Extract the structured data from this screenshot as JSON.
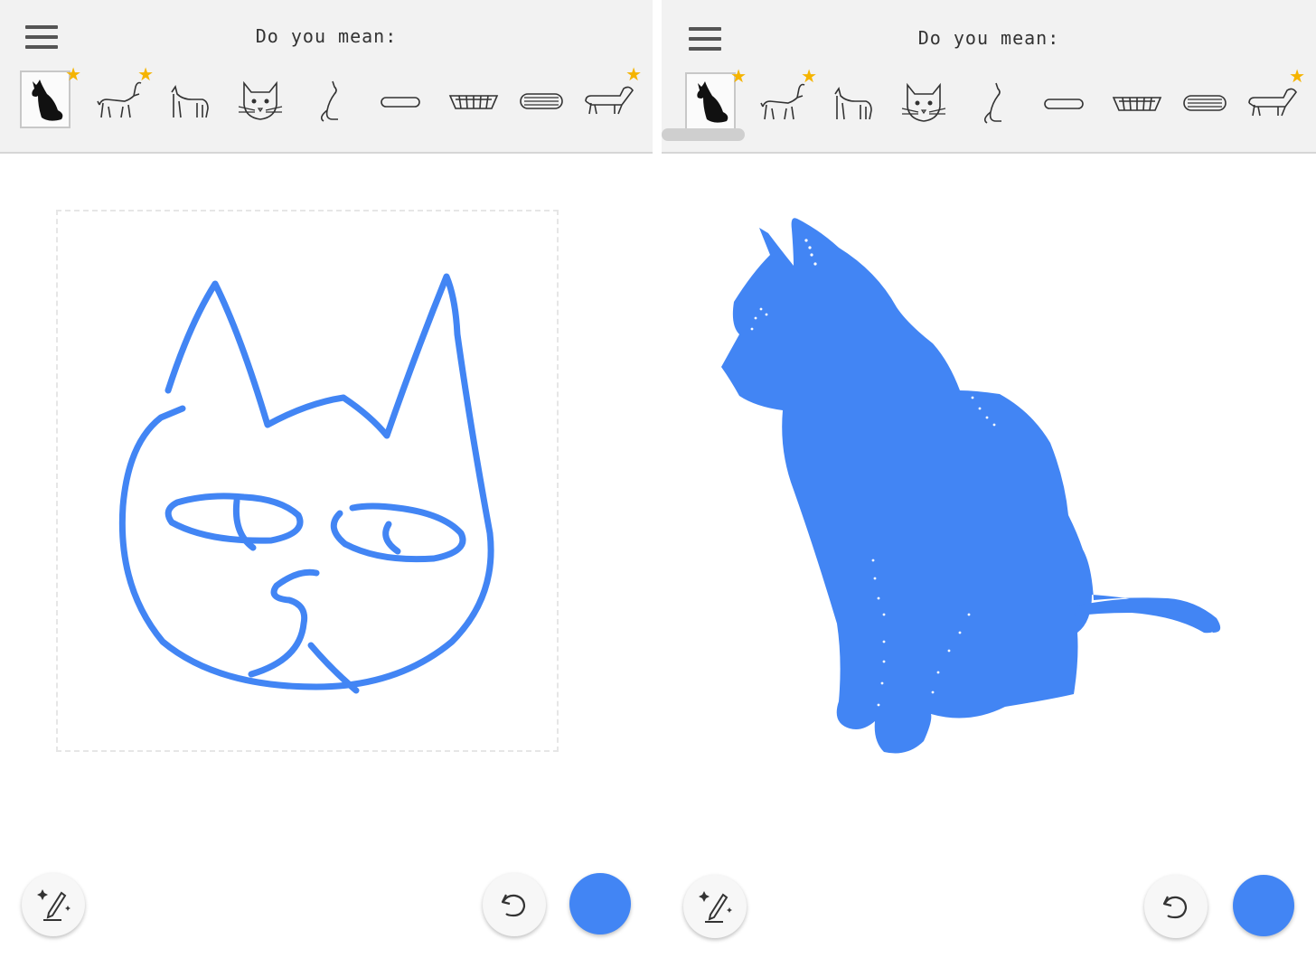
{
  "prompt": "Do you mean:",
  "accent_color": "#4285f4",
  "star_color": "#f5b400",
  "suggestions": [
    {
      "icon": "sitting-cat-silhouette-icon",
      "selected": true,
      "starred": true
    },
    {
      "icon": "walking-cat-icon",
      "starred": true
    },
    {
      "icon": "cat-icon"
    },
    {
      "icon": "cat-face-icon"
    },
    {
      "icon": "sitting-cat-outline-icon"
    },
    {
      "icon": "hot-dog-icon"
    },
    {
      "icon": "basket-icon"
    },
    {
      "icon": "hot-dog-bun-icon"
    },
    {
      "icon": "dachshund-icon",
      "starred": true
    }
  ],
  "left_panel": {
    "canvas": "hand-drawn-cat-face-sketch"
  },
  "right_panel": {
    "canvas": "autodraw-cat-silhouette"
  },
  "buttons": [
    "autodraw-pencil-icon",
    "undo-icon",
    "color-picker"
  ]
}
